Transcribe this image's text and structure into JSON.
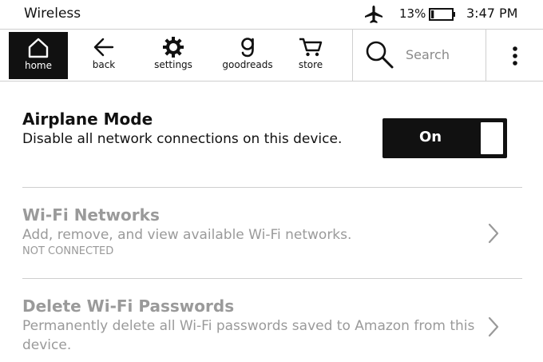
{
  "status_bar": {
    "title": "Wireless",
    "battery_percent": "13%",
    "battery_level": 0.13,
    "time": "3:47 PM",
    "icons": [
      "airplane-icon",
      "battery-icon"
    ]
  },
  "toolbar": {
    "items": [
      {
        "label": "home",
        "icon": "home-icon",
        "active": true
      },
      {
        "label": "back",
        "icon": "back-arrow-icon"
      },
      {
        "label": "settings",
        "icon": "gear-icon"
      },
      {
        "label": "goodreads",
        "icon": "goodreads-icon"
      },
      {
        "label": "store",
        "icon": "cart-icon"
      }
    ],
    "search_placeholder": "Search",
    "menu_icon": "more-vertical-icon"
  },
  "settings": {
    "airplane": {
      "title": "Airplane Mode",
      "description": "Disable all network connections on this device.",
      "toggle_label": "On",
      "enabled": true
    },
    "wifi": {
      "title": "Wi-Fi Networks",
      "description": "Add, remove, and view available Wi-Fi networks.",
      "status": "NOT CONNECTED"
    },
    "delete_passwords": {
      "title": "Delete Wi-Fi Passwords",
      "description": "Permanently delete all Wi-Fi passwords saved to Amazon from this device."
    }
  },
  "colors": {
    "text": "#111111",
    "disabled_text": "#9a9a9a",
    "divider": "#cfcfcf",
    "toggle_bg": "#111111"
  }
}
